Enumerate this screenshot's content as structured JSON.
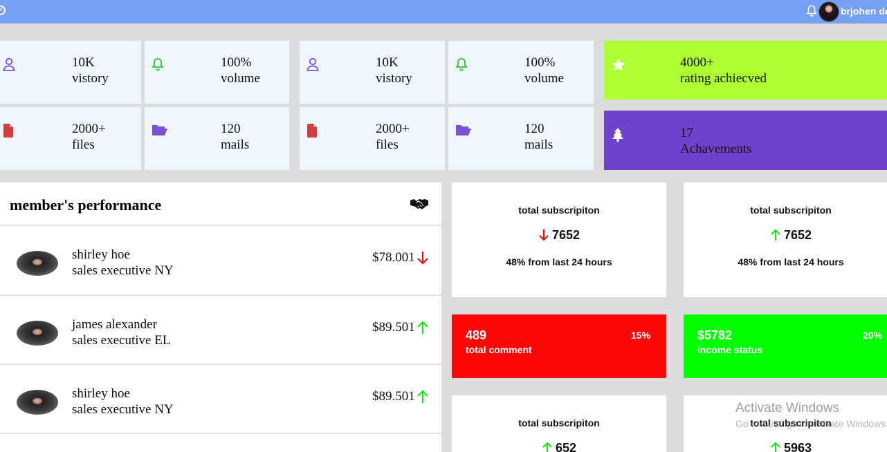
{
  "header": {
    "user_name": "brjohen de",
    "close_icon": "circle-x-icon",
    "bell_icon": "bell-icon",
    "bg_color": "#76a0f2"
  },
  "stats": [
    {
      "icon": "user-icon",
      "value": "10K",
      "label": "vistory"
    },
    {
      "icon": "bell-icon",
      "value": "100%",
      "label": "volume"
    },
    {
      "icon": "user-icon",
      "value": "10K",
      "label": "vistory"
    },
    {
      "icon": "bell-icon",
      "value": "100%",
      "label": "volume"
    },
    {
      "icon": "file-icon",
      "value": "2000+",
      "label": "files"
    },
    {
      "icon": "folder-icon",
      "value": "120",
      "label": "mails"
    },
    {
      "icon": "file-icon",
      "value": "2000+",
      "label": "files"
    },
    {
      "icon": "folder-icon",
      "value": "120",
      "label": "mails"
    }
  ],
  "highlights": [
    {
      "icon": "star-icon",
      "value": "4000+",
      "label": "rating achiecved",
      "color": "#adff2f"
    },
    {
      "icon": "tree-icon",
      "value": "17",
      "label": "Achavements",
      "color": "#6f42cc"
    }
  ],
  "performance": {
    "title": "member's performance",
    "icon": "handshake-icon",
    "members": [
      {
        "name": "shirley hoe",
        "role": "sales executive NY",
        "amount": "$78.001",
        "trend": "down"
      },
      {
        "name": "james alexander",
        "role": "sales executive EL",
        "amount": "$89.501",
        "trend": "up"
      },
      {
        "name": "shirley hoe",
        "role": "sales executive NY",
        "amount": "$89.501",
        "trend": "up"
      }
    ]
  },
  "subscriptions": [
    {
      "title": "total subscripiton",
      "value": "7652",
      "trend": "down",
      "note": "48% from last 24 hours"
    },
    {
      "title": "total subscripiton",
      "value": "7652",
      "trend": "up",
      "note": "48% from last 24 hours"
    },
    {
      "title": "total subscripiton",
      "value": "652",
      "trend": "up",
      "note": ""
    },
    {
      "title": "total subscripiton",
      "value": "5963",
      "trend": "up",
      "note": ""
    }
  ],
  "color_boxes": [
    {
      "number": "489",
      "label": "total comment",
      "percent": "15%",
      "color": "#ff0606"
    },
    {
      "number": "$5782",
      "label": "income status",
      "percent": "20%",
      "color": "#00ff00"
    }
  ],
  "watermark": {
    "line1": "Activate Windows",
    "line2": "Go to Settings to activate Windows."
  },
  "colors": {
    "trend_up": "#1ee01e",
    "trend_down": "#e01010",
    "user_icon": "#7b4fd6",
    "bell_icon": "#2ec22e",
    "file_icon": "#d43d3d",
    "folder_icon": "#7b4fd6"
  }
}
